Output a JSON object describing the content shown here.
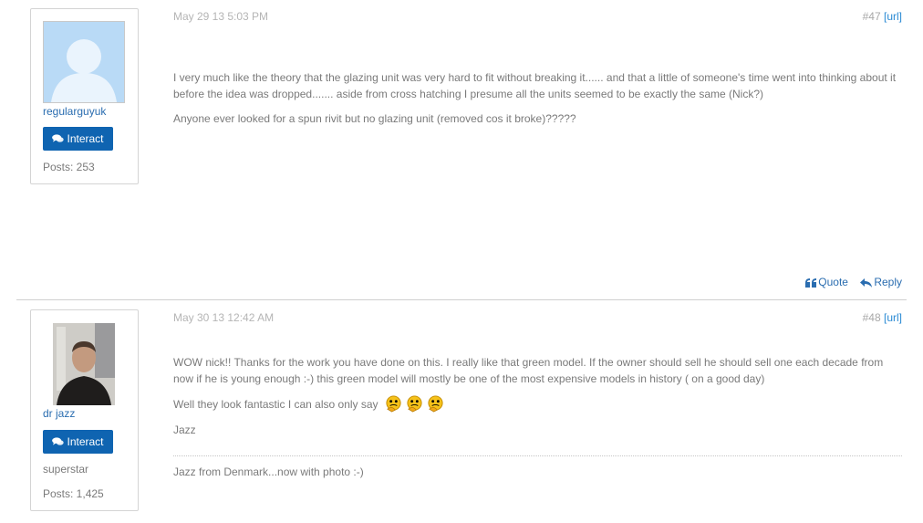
{
  "posts": [
    {
      "username": "regularguyuk",
      "interact_label": "Interact",
      "posts_count": "Posts: 253",
      "date": "May 29 13 5:03 PM",
      "post_number": "#47",
      "url_label": "[url]",
      "paragraphs": [
        "I very much like the theory that the glazing unit was very hard to fit without breaking it...... and that a little of someone's time went into thinking about it before the idea was dropped....... aside from cross hatching I presume all the units seemed to be exactly the same (Nick?)",
        "Anyone ever looked for a spun rivit but no glazing unit (removed cos it broke)?????"
      ],
      "quote_label": "Quote",
      "reply_label": "Reply"
    },
    {
      "username": "dr jazz",
      "interact_label": "Interact",
      "rank": "superstar",
      "posts_count": "Posts: 1,425",
      "date": "May 30 13 12:42 AM",
      "post_number": "#48",
      "url_label": "[url]",
      "paragraphs": [
        "WOW nick!! Thanks for the work you have done on this. I really like that green model. If the owner should sell he should sell one each decade from now if he is young enough :-) this green model will mostly be one of the most expensive models in history ( on a good day)",
        "Well they look fantastic I can also only say",
        "Jazz"
      ],
      "emoji_icons": [
        "thinking-smiley-icon",
        "thinking-smiley-icon",
        "thinking-smiley-icon"
      ],
      "signature": "Jazz from Denmark...now with photo :-)"
    }
  ],
  "colors": {
    "accent": "#0f64b1",
    "link": "#2a6db0",
    "muted_text": "#7a7a7a",
    "date_text": "#b5b5b5"
  }
}
